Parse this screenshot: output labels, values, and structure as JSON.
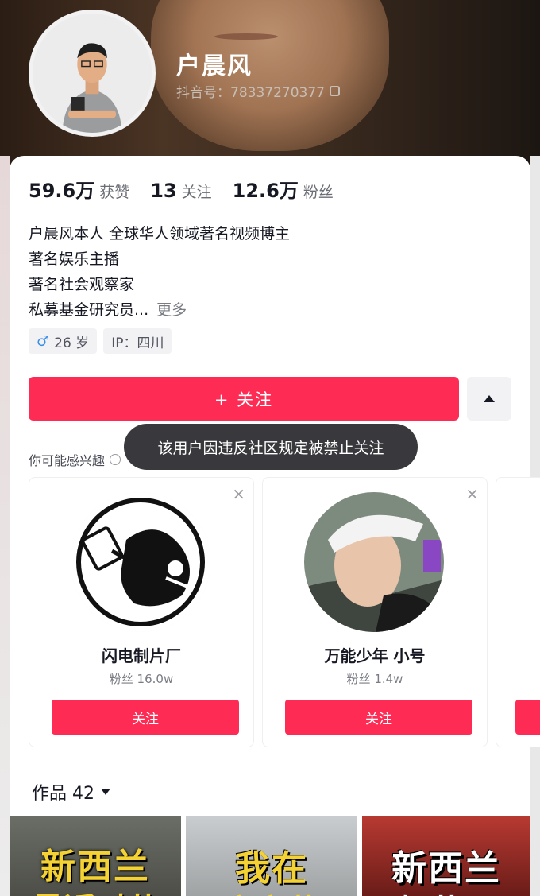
{
  "profile": {
    "name": "户晨风",
    "douyin_id": "抖音号：78337270377",
    "stats": [
      {
        "num": "59.6万",
        "label": "获赞"
      },
      {
        "num": "13",
        "label": "关注"
      },
      {
        "num": "12.6万",
        "label": "粉丝"
      }
    ],
    "bio": [
      "户晨风本人  全球华人领域著名视频博主",
      "著名娱乐主播",
      "著名社会观察家",
      "私募基金研究员..."
    ],
    "bio_more": "更多",
    "tags": {
      "age": "26 岁",
      "ip": "IP：四川"
    },
    "follow_label": "+ 关注"
  },
  "toast": "该用户因违反社区规定被禁止关注",
  "interest_title": "你可能感兴趣",
  "recommendations": [
    {
      "name": "闪电制片厂",
      "fans": "粉丝 16.0w",
      "follow": "关注",
      "close": "×"
    },
    {
      "name": "万能少年 小号",
      "fans": "粉丝 1.4w",
      "follow": "关注",
      "close": "×"
    }
  ],
  "works": {
    "label": "作品 42"
  },
  "thumbnails": [
    {
      "line1": "新西兰",
      "line2": "最近对节"
    },
    {
      "line1": "我在",
      "line2": "字市花"
    },
    {
      "line1": "新西兰",
      "line2": "好节工"
    }
  ],
  "colors": {
    "accent": "#fe2c55",
    "text": "#161823",
    "toast_bg": "#28282c"
  }
}
